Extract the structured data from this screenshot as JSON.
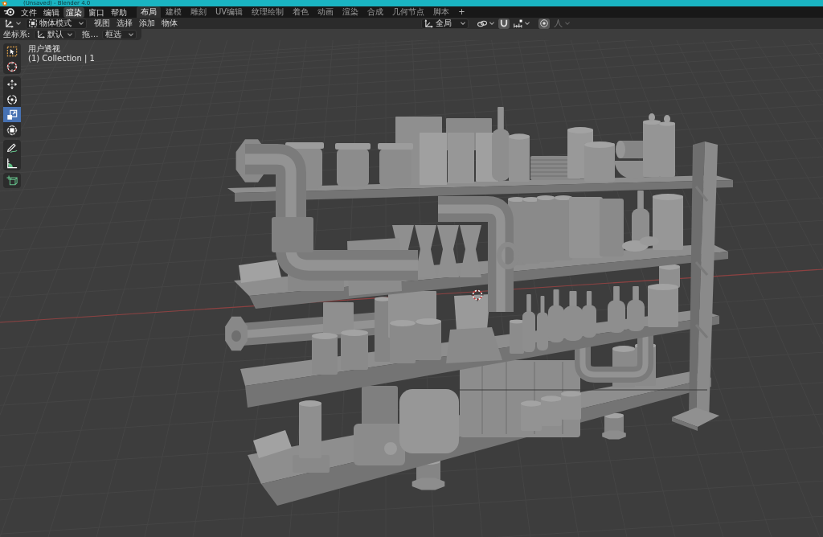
{
  "window": {
    "title": "(Unsaved) - Blender 4.0"
  },
  "menu_bar": [
    {
      "label": "文件",
      "selected": false
    },
    {
      "label": "编辑",
      "selected": false
    },
    {
      "label": "渲染",
      "selected": true
    },
    {
      "label": "窗口",
      "selected": false
    },
    {
      "label": "帮助",
      "selected": false
    }
  ],
  "workspace_tabs": {
    "tabs": [
      {
        "label": "布局",
        "selected": true
      },
      {
        "label": "建模",
        "selected": false
      },
      {
        "label": "雕刻",
        "selected": false
      },
      {
        "label": "UV编辑",
        "selected": false
      },
      {
        "label": "纹理绘制",
        "selected": false
      },
      {
        "label": "着色",
        "selected": false
      },
      {
        "label": "动画",
        "selected": false
      },
      {
        "label": "渲染",
        "selected": false
      },
      {
        "label": "合成",
        "selected": false
      },
      {
        "label": "几何节点",
        "selected": false
      },
      {
        "label": "脚本",
        "selected": false
      }
    ],
    "add_button": "+"
  },
  "header": {
    "mode": "物体模式",
    "menus": [
      "视图",
      "选择",
      "添加",
      "物体"
    ],
    "orientation": "全局",
    "snap": {
      "on": true
    },
    "proportional_editing": {
      "on": true
    },
    "falloff": {
      "disabled": true
    }
  },
  "tool_settings": {
    "coordinate_label": "坐标系:",
    "coordinate_value": "默认",
    "drag_label": "拖…",
    "select_mode": "框选"
  },
  "toolbar": [
    {
      "tools": [
        {
          "kind": "select-box",
          "selected": false
        },
        {
          "kind": "cursor",
          "selected": false
        }
      ]
    },
    {
      "tools": [
        {
          "kind": "move",
          "selected": false
        },
        {
          "kind": "rotate",
          "selected": false
        },
        {
          "kind": "scale",
          "selected": true
        },
        {
          "kind": "transform",
          "selected": false
        }
      ]
    },
    {
      "tools": [
        {
          "kind": "annotate",
          "selected": false
        },
        {
          "kind": "measure",
          "selected": false
        }
      ]
    },
    {
      "tools": [
        {
          "kind": "add-cube",
          "selected": false
        }
      ]
    }
  ],
  "viewport": {
    "view_name": "用户透视",
    "collection": "(1) Collection | 1"
  }
}
